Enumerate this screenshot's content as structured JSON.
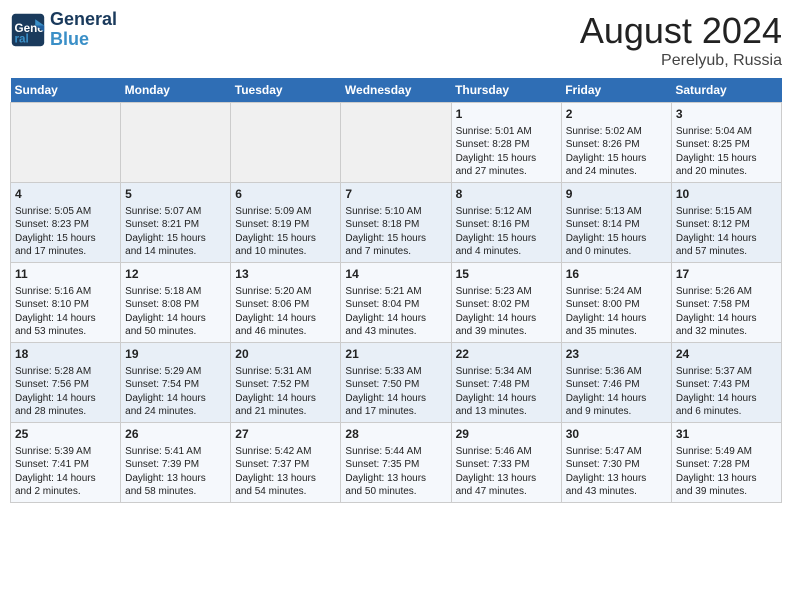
{
  "header": {
    "logo_line1": "General",
    "logo_line2": "Blue",
    "main_title": "August 2024",
    "sub_title": "Perelyub, Russia"
  },
  "days_of_week": [
    "Sunday",
    "Monday",
    "Tuesday",
    "Wednesday",
    "Thursday",
    "Friday",
    "Saturday"
  ],
  "weeks": [
    [
      {
        "day": "",
        "info": ""
      },
      {
        "day": "",
        "info": ""
      },
      {
        "day": "",
        "info": ""
      },
      {
        "day": "",
        "info": ""
      },
      {
        "day": "1",
        "info": "Sunrise: 5:01 AM\nSunset: 8:28 PM\nDaylight: 15 hours\nand 27 minutes."
      },
      {
        "day": "2",
        "info": "Sunrise: 5:02 AM\nSunset: 8:26 PM\nDaylight: 15 hours\nand 24 minutes."
      },
      {
        "day": "3",
        "info": "Sunrise: 5:04 AM\nSunset: 8:25 PM\nDaylight: 15 hours\nand 20 minutes."
      }
    ],
    [
      {
        "day": "4",
        "info": "Sunrise: 5:05 AM\nSunset: 8:23 PM\nDaylight: 15 hours\nand 17 minutes."
      },
      {
        "day": "5",
        "info": "Sunrise: 5:07 AM\nSunset: 8:21 PM\nDaylight: 15 hours\nand 14 minutes."
      },
      {
        "day": "6",
        "info": "Sunrise: 5:09 AM\nSunset: 8:19 PM\nDaylight: 15 hours\nand 10 minutes."
      },
      {
        "day": "7",
        "info": "Sunrise: 5:10 AM\nSunset: 8:18 PM\nDaylight: 15 hours\nand 7 minutes."
      },
      {
        "day": "8",
        "info": "Sunrise: 5:12 AM\nSunset: 8:16 PM\nDaylight: 15 hours\nand 4 minutes."
      },
      {
        "day": "9",
        "info": "Sunrise: 5:13 AM\nSunset: 8:14 PM\nDaylight: 15 hours\nand 0 minutes."
      },
      {
        "day": "10",
        "info": "Sunrise: 5:15 AM\nSunset: 8:12 PM\nDaylight: 14 hours\nand 57 minutes."
      }
    ],
    [
      {
        "day": "11",
        "info": "Sunrise: 5:16 AM\nSunset: 8:10 PM\nDaylight: 14 hours\nand 53 minutes."
      },
      {
        "day": "12",
        "info": "Sunrise: 5:18 AM\nSunset: 8:08 PM\nDaylight: 14 hours\nand 50 minutes."
      },
      {
        "day": "13",
        "info": "Sunrise: 5:20 AM\nSunset: 8:06 PM\nDaylight: 14 hours\nand 46 minutes."
      },
      {
        "day": "14",
        "info": "Sunrise: 5:21 AM\nSunset: 8:04 PM\nDaylight: 14 hours\nand 43 minutes."
      },
      {
        "day": "15",
        "info": "Sunrise: 5:23 AM\nSunset: 8:02 PM\nDaylight: 14 hours\nand 39 minutes."
      },
      {
        "day": "16",
        "info": "Sunrise: 5:24 AM\nSunset: 8:00 PM\nDaylight: 14 hours\nand 35 minutes."
      },
      {
        "day": "17",
        "info": "Sunrise: 5:26 AM\nSunset: 7:58 PM\nDaylight: 14 hours\nand 32 minutes."
      }
    ],
    [
      {
        "day": "18",
        "info": "Sunrise: 5:28 AM\nSunset: 7:56 PM\nDaylight: 14 hours\nand 28 minutes."
      },
      {
        "day": "19",
        "info": "Sunrise: 5:29 AM\nSunset: 7:54 PM\nDaylight: 14 hours\nand 24 minutes."
      },
      {
        "day": "20",
        "info": "Sunrise: 5:31 AM\nSunset: 7:52 PM\nDaylight: 14 hours\nand 21 minutes."
      },
      {
        "day": "21",
        "info": "Sunrise: 5:33 AM\nSunset: 7:50 PM\nDaylight: 14 hours\nand 17 minutes."
      },
      {
        "day": "22",
        "info": "Sunrise: 5:34 AM\nSunset: 7:48 PM\nDaylight: 14 hours\nand 13 minutes."
      },
      {
        "day": "23",
        "info": "Sunrise: 5:36 AM\nSunset: 7:46 PM\nDaylight: 14 hours\nand 9 minutes."
      },
      {
        "day": "24",
        "info": "Sunrise: 5:37 AM\nSunset: 7:43 PM\nDaylight: 14 hours\nand 6 minutes."
      }
    ],
    [
      {
        "day": "25",
        "info": "Sunrise: 5:39 AM\nSunset: 7:41 PM\nDaylight: 14 hours\nand 2 minutes."
      },
      {
        "day": "26",
        "info": "Sunrise: 5:41 AM\nSunset: 7:39 PM\nDaylight: 13 hours\nand 58 minutes."
      },
      {
        "day": "27",
        "info": "Sunrise: 5:42 AM\nSunset: 7:37 PM\nDaylight: 13 hours\nand 54 minutes."
      },
      {
        "day": "28",
        "info": "Sunrise: 5:44 AM\nSunset: 7:35 PM\nDaylight: 13 hours\nand 50 minutes."
      },
      {
        "day": "29",
        "info": "Sunrise: 5:46 AM\nSunset: 7:33 PM\nDaylight: 13 hours\nand 47 minutes."
      },
      {
        "day": "30",
        "info": "Sunrise: 5:47 AM\nSunset: 7:30 PM\nDaylight: 13 hours\nand 43 minutes."
      },
      {
        "day": "31",
        "info": "Sunrise: 5:49 AM\nSunset: 7:28 PM\nDaylight: 13 hours\nand 39 minutes."
      }
    ]
  ]
}
